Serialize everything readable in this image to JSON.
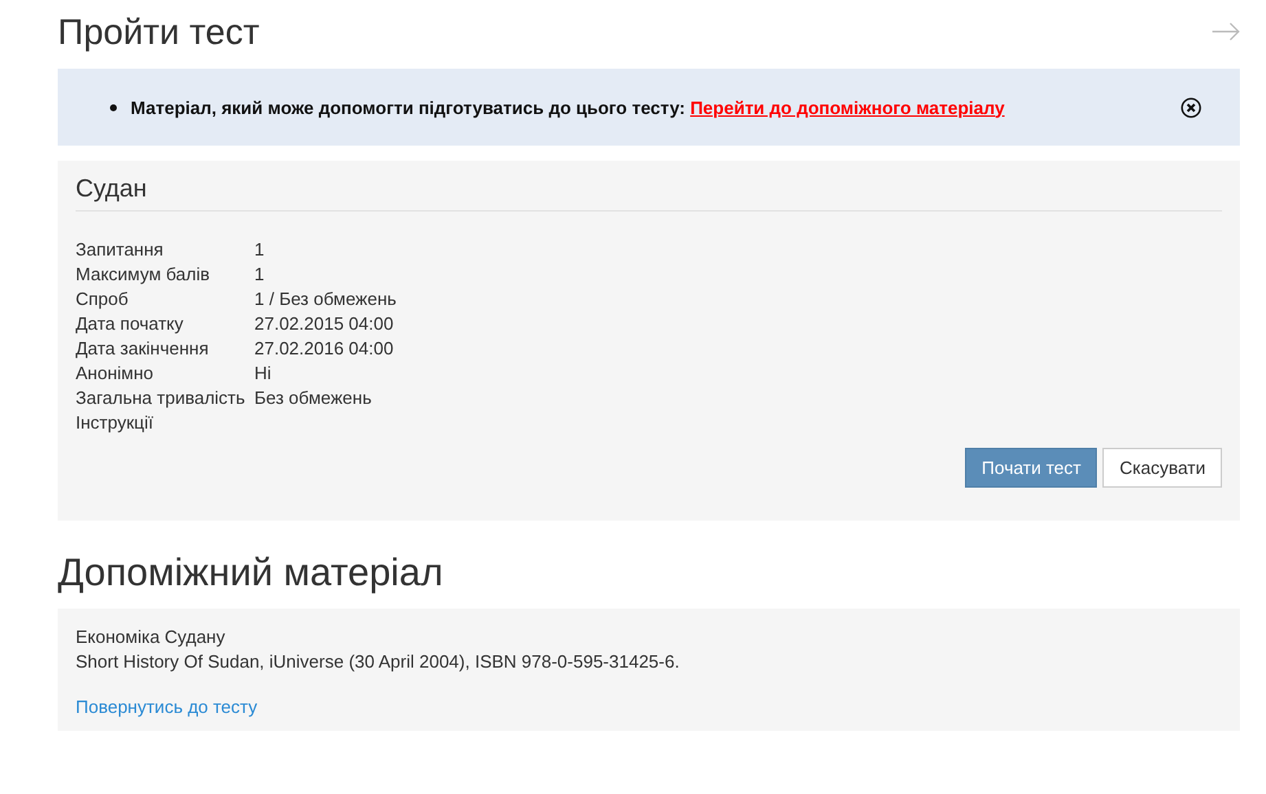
{
  "page_title": "Пройти тест",
  "notice": {
    "text": "Матеріал, який може допомогти підготуватись до цього тесту:",
    "link": "Перейти до допоміжного матеріалу"
  },
  "test": {
    "title": "Судан",
    "details": [
      {
        "label": "Запитання",
        "value": "1"
      },
      {
        "label": "Максимум балів",
        "value": "1"
      },
      {
        "label": "Спроб",
        "value": "1 / Без обмежень"
      },
      {
        "label": "Дата початку",
        "value": "27.02.2015 04:00"
      },
      {
        "label": "Дата закінчення",
        "value": "27.02.2016 04:00"
      },
      {
        "label": "Анонімно",
        "value": "Ні"
      },
      {
        "label": "Загальна тривалість",
        "value": "Без обмежень"
      },
      {
        "label": "Інструкції"
      }
    ],
    "buttons": [
      {
        "label": "Почати тест",
        "kind": "primary"
      },
      {
        "label": "Скасувати",
        "kind": "default"
      }
    ]
  },
  "material": {
    "heading": "Допоміжний матеріал",
    "lines": [
      "Економіка Судану",
      "Short History Of Sudan, iUniverse (30 April 2004), ISBN 978-0-595-31425-6."
    ],
    "back_link": "Повернутись до тесту"
  }
}
